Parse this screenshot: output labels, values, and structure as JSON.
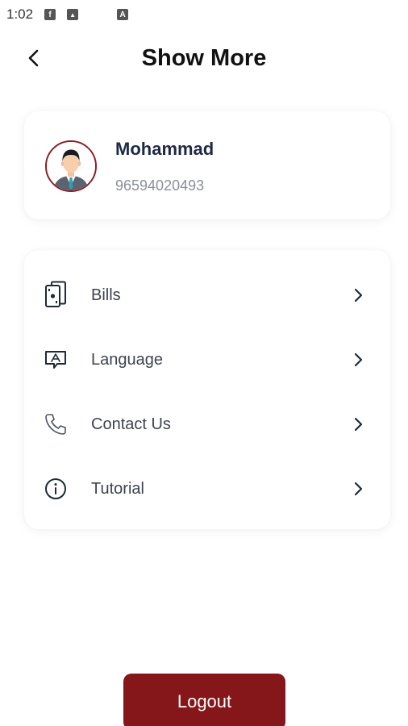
{
  "status_bar": {
    "time": "1:02",
    "icons": [
      "facebook-icon",
      "image-icon",
      "a-box-icon"
    ],
    "icon_glyphs": [
      "f",
      "▲",
      "A"
    ]
  },
  "header": {
    "title": "Show More",
    "back_icon": "back-arrow-icon"
  },
  "profile": {
    "name": "Mohammad",
    "phone": "96594020493",
    "avatar_icon": "user-avatar-icon"
  },
  "menu": {
    "items": [
      {
        "label": "Bills",
        "icon": "bills-icon"
      },
      {
        "label": "Language",
        "icon": "language-icon"
      },
      {
        "label": "Contact Us",
        "icon": "phone-icon"
      },
      {
        "label": "Tutorial",
        "icon": "info-icon"
      }
    ]
  },
  "logout": {
    "label": "Logout"
  },
  "colors": {
    "brand": "#85161a",
    "avatar_border": "#8b1e22",
    "name_text": "#1e2a44",
    "muted_text": "#8a8f99"
  }
}
